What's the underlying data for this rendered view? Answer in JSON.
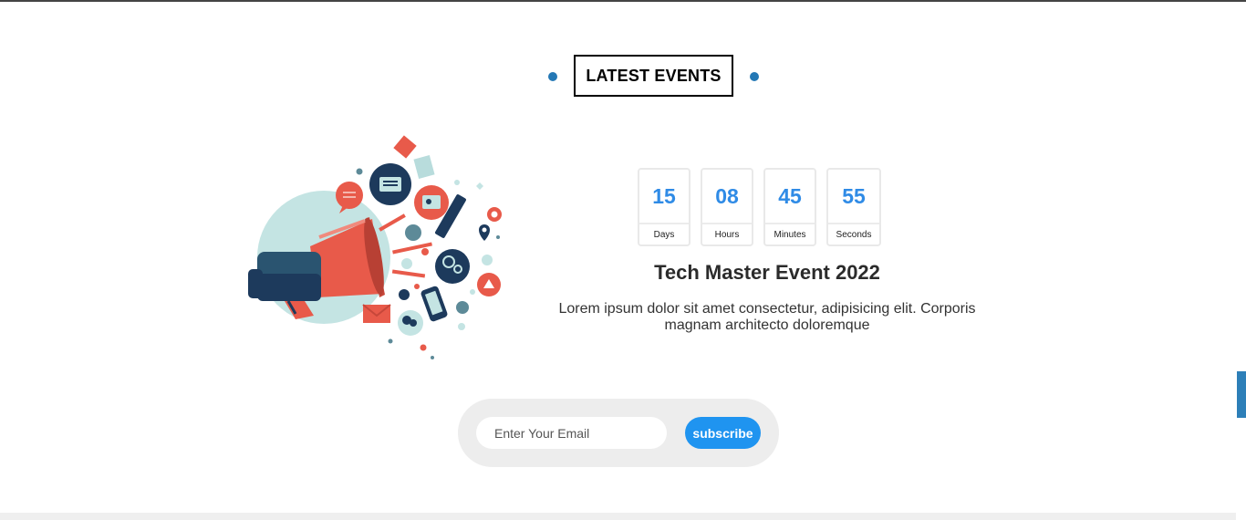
{
  "section": {
    "title": "LATEST EVENTS"
  },
  "illustration": {
    "icon": "megaphone-marketing-illustration",
    "colors": {
      "navy": "#1d3a5c",
      "red": "#e85a4a",
      "teal": "#c4e4e3",
      "blue_grey": "#5d8a98"
    }
  },
  "countdown": {
    "days": {
      "value": "15",
      "label": "Days"
    },
    "hours": {
      "value": "08",
      "label": "Hours"
    },
    "minutes": {
      "value": "45",
      "label": "Minutes"
    },
    "seconds": {
      "value": "55",
      "label": "Seconds"
    }
  },
  "event": {
    "title": "Tech Master Event 2022",
    "description": "Lorem ipsum dolor sit amet consectetur, adipisicing elit. Corporis magnam architecto doloremque"
  },
  "subscribe": {
    "placeholder": "Enter Your Email",
    "button_label": "subscribe"
  },
  "colors": {
    "accent": "#1f94f0",
    "number": "#2f8be6",
    "dot": "#2478b5",
    "side_tab": "#2d7fb8"
  }
}
